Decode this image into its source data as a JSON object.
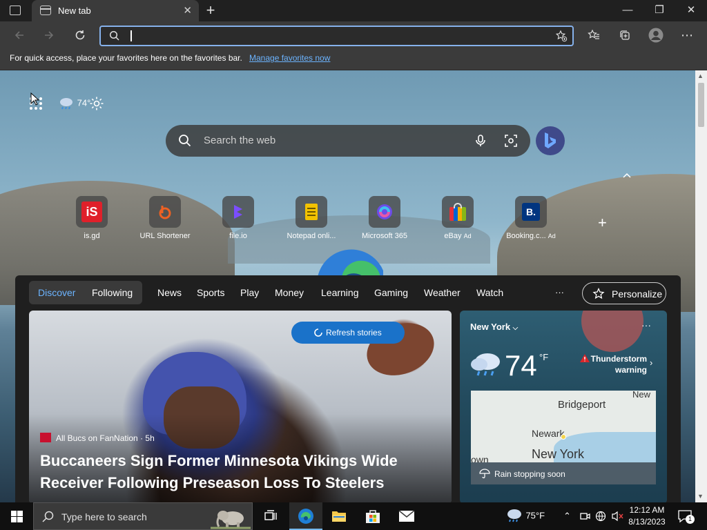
{
  "browser": {
    "tab_title": "New tab",
    "tab_close": "✕",
    "new_tab": "+",
    "window_controls": {
      "minimize": "—",
      "restore": "❐",
      "close": "✕"
    },
    "address_value": "",
    "icons": {
      "back": "back-arrow-icon",
      "forward": "forward-arrow-icon",
      "refresh": "refresh-icon",
      "search": "search-icon",
      "add_favorite": "star-plus-icon",
      "favorites": "favorites-icon",
      "collections": "collections-icon",
      "profile": "profile-icon",
      "menu": "more-menu-icon"
    },
    "more_glyph": "⋯"
  },
  "favorites_bar": {
    "message": "For quick access, place your favorites here on the favorites bar.",
    "link": "Manage favorites now"
  },
  "newtab": {
    "weather_mini": "74°",
    "search_placeholder": "Search the web",
    "add_site": "+",
    "quick_links": [
      {
        "label": "is.gd",
        "ad": "",
        "icon": "isgd-icon",
        "color": "#e0202a"
      },
      {
        "label": "URL Shortener",
        "ad": "",
        "icon": "bitly-icon",
        "color": "#ee6123"
      },
      {
        "label": "file.io",
        "ad": "",
        "icon": "fileio-icon",
        "color": "#7b4dff"
      },
      {
        "label": "Notepad onli...",
        "ad": "",
        "icon": "notepad-icon",
        "color": "#f2c200"
      },
      {
        "label": "Microsoft 365",
        "ad": "",
        "icon": "microsoft365-icon",
        "color": "#6c4ce8"
      },
      {
        "label": "eBay",
        "ad": "Ad",
        "icon": "ebay-bag-icon",
        "color": "#e53238"
      },
      {
        "label": "Booking.c...",
        "ad": "Ad",
        "icon": "booking-icon",
        "color": "#003580"
      }
    ]
  },
  "feed": {
    "tabs": [
      "Discover",
      "Following",
      "News",
      "Sports",
      "Play",
      "Money",
      "Learning",
      "Gaming",
      "Weather",
      "Watch"
    ],
    "more": "···",
    "personalize": "Personalize",
    "refresh": "Refresh stories",
    "hero": {
      "source": "All Bucs on FanNation · 5h",
      "headline": "Buccaneers Sign Former Minnesota Vikings Wide Receiver Following Preseason Loss To Steelers"
    },
    "weather": {
      "city": "New York",
      "more": "···",
      "temp": "74",
      "unit": "°F",
      "alert_line1": "Thunderstorm",
      "alert_line2": "warning",
      "map_labels": [
        "Bridgeport",
        "New",
        "Newark",
        "New York",
        "own"
      ],
      "note": "Rain stopping soon"
    }
  },
  "taskbar": {
    "search_placeholder": "Type here to search",
    "weather": "75°F",
    "time": "12:12 AM",
    "date": "8/13/2023",
    "notification_count": "1"
  }
}
